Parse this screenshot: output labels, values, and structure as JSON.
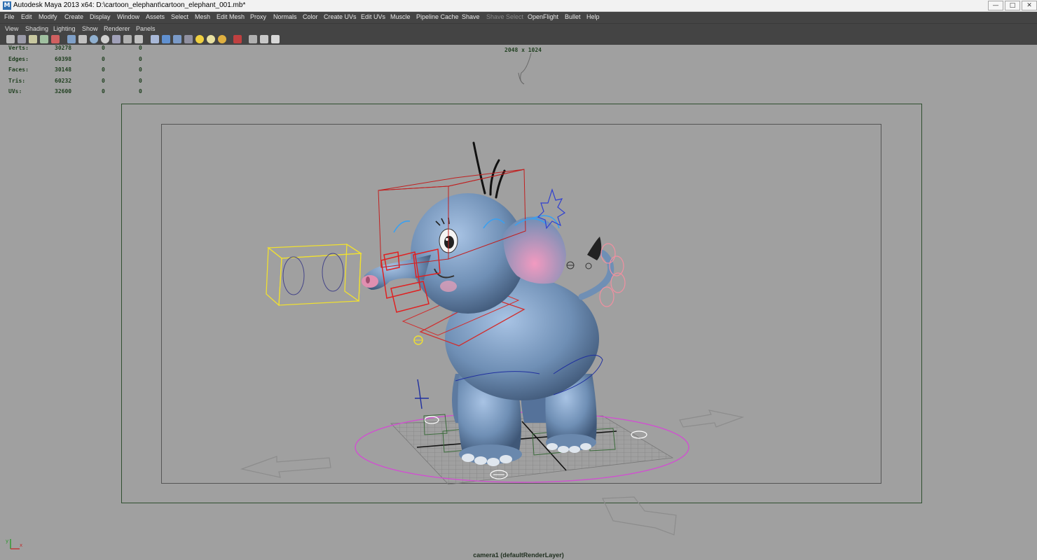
{
  "window": {
    "title": "Autodesk Maya 2013 x64: D:\\cartoon_elephant\\cartoon_elephant_001.mb*",
    "icon": "maya-logo-icon"
  },
  "menubar": {
    "items": [
      "File",
      "Edit",
      "Modify",
      "Create",
      "Display",
      "Window",
      "Assets",
      "Select",
      "Mesh",
      "Edit Mesh",
      "Proxy",
      "Normals",
      "Color",
      "Create UVs",
      "Edit UVs",
      "Muscle",
      "Pipeline Cache",
      "Shave",
      "Shave Select",
      "OpenFlight",
      "Bullet",
      "Help"
    ],
    "disabled": [
      "Shave Select"
    ]
  },
  "panel_menu": {
    "items": [
      "View",
      "Shading",
      "Lighting",
      "Show",
      "Renderer",
      "Panels"
    ]
  },
  "hud": {
    "rows": [
      {
        "label": "Verts:",
        "v1": "30278",
        "v2": "0",
        "v3": "0"
      },
      {
        "label": "Edges:",
        "v1": "60398",
        "v2": "0",
        "v3": "0"
      },
      {
        "label": "Faces:",
        "v1": "30148",
        "v2": "0",
        "v3": "0"
      },
      {
        "label": "Tris:",
        "v1": "60232",
        "v2": "0",
        "v3": "0"
      },
      {
        "label": "UVs:",
        "v1": "32600",
        "v2": "0",
        "v3": "0"
      }
    ],
    "resolution": "2048 x 1024"
  },
  "viewport": {
    "camera_label": "camera1 (defaultRenderLayer)",
    "background": "#a0a0a0"
  },
  "colors": {
    "menubar_bg": "#444444",
    "hud_text": "#1f3f1f",
    "elephant_body": "#6f8fb5",
    "ear_pink": "#e37fae",
    "control_red": "#d03030",
    "control_yellow": "#f0e030",
    "control_magenta": "#d050d0"
  },
  "axis_gizmo": {
    "y": "y",
    "x": "x"
  }
}
